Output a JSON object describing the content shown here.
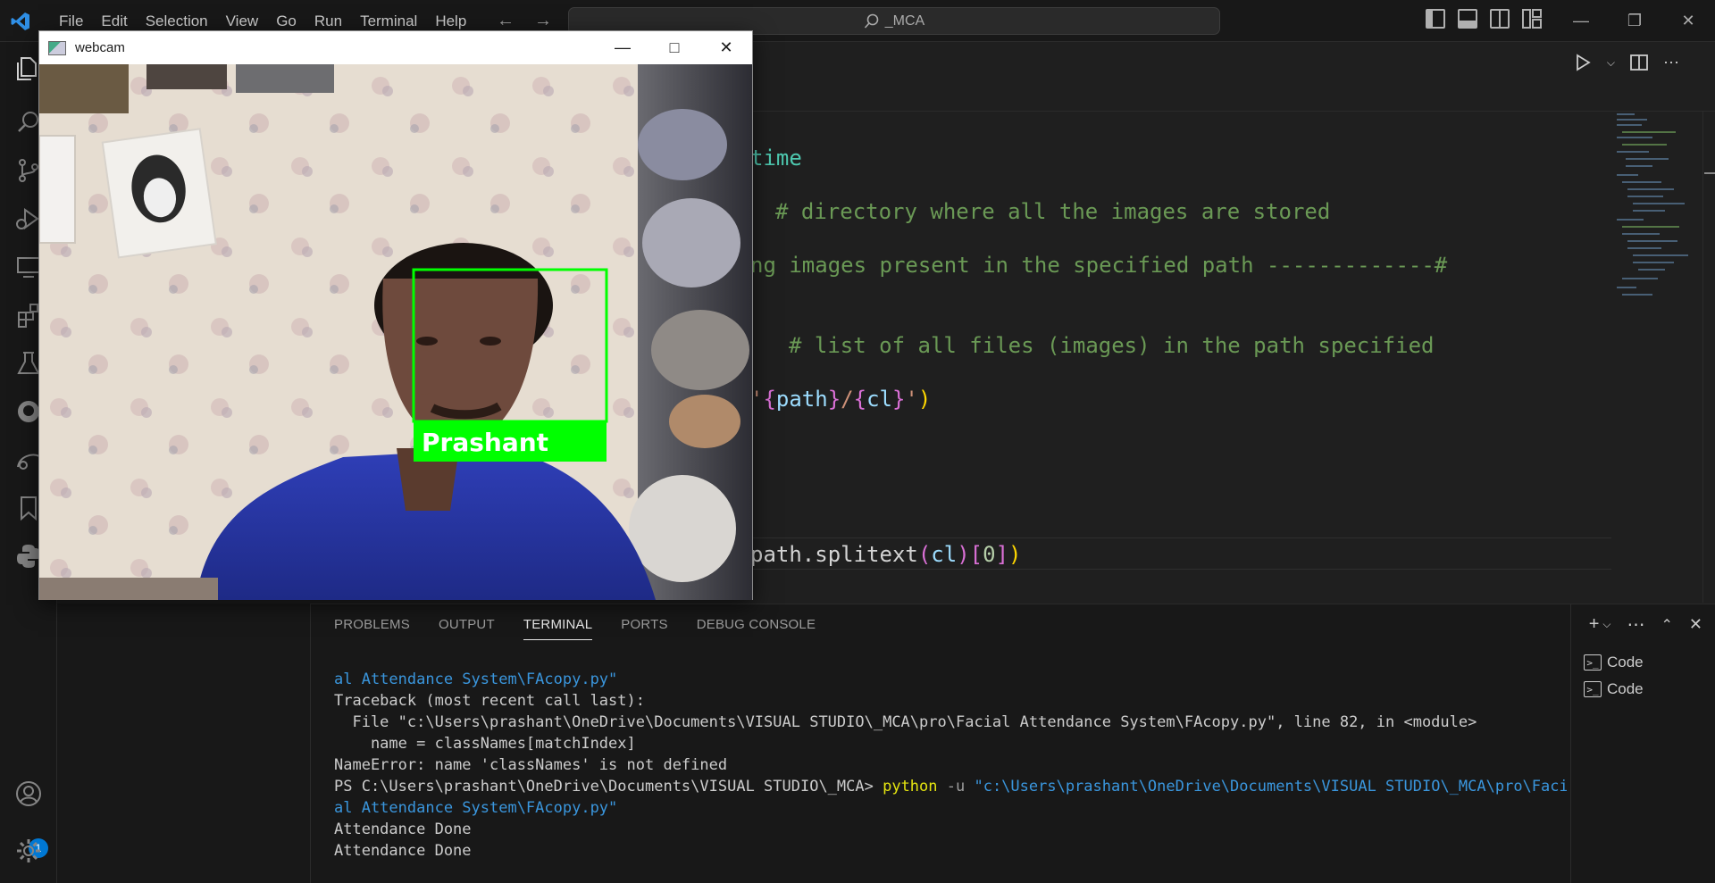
{
  "titlebar": {
    "menu": [
      "File",
      "Edit",
      "Selection",
      "View",
      "Go",
      "Run",
      "Terminal",
      "Help"
    ],
    "search": "_MCA"
  },
  "activity_badge": "1",
  "code_lines": {
    "l1": "time",
    "l2": "# directory where all the images are stored",
    "l3": "ng images present in the specified path -------------#",
    "l4": "# list of all files (images) in the path specified",
    "l5": {
      "a": "'",
      "b": "{",
      "c": "path",
      "d": "}",
      "e": "/",
      "f": "{",
      "g": "cl",
      "h": "}",
      "i": "'",
      "j": ")"
    },
    "l6": {
      "a": "path.splitext",
      "b": "(",
      "c": "cl",
      "d": ")",
      "e": "[",
      "f": "0",
      "g": "]",
      "h": ")"
    }
  },
  "panel": {
    "tabs": [
      "PROBLEMS",
      "OUTPUT",
      "TERMINAL",
      "PORTS",
      "DEBUG CONSOLE"
    ],
    "active_tab": "TERMINAL",
    "terminal_lines": [
      {
        "text": "al Attendance System\\FAcopy.py\"",
        "kind": "link"
      },
      {
        "text": "Traceback (most recent call last):",
        "kind": "plain"
      },
      {
        "text": "  File \"c:\\Users\\prashant\\OneDrive\\Documents\\VISUAL STUDIO\\_MCA\\pro\\Facial Attendance System\\FAcopy.py\", line 82, in <module>",
        "kind": "plain"
      },
      {
        "text": "    name = classNames[matchIndex]",
        "kind": "plain"
      },
      {
        "text": "NameError: name 'classNames' is not defined",
        "kind": "plain"
      }
    ],
    "prompt": {
      "ps": "PS C:\\Users\\prashant\\OneDrive\\Documents\\VISUAL STUDIO\\_MCA> ",
      "cmd": "python",
      "flag": " -u ",
      "arg": "\"c:\\Users\\prashant\\OneDrive\\Documents\\VISUAL STUDIO\\_MCA\\pro\\Faci"
    },
    "after_lines": [
      {
        "text": "al Attendance System\\FAcopy.py\"",
        "kind": "link"
      },
      {
        "text": "Attendance Done",
        "kind": "plain"
      },
      {
        "text": "Attendance Done",
        "kind": "plain"
      }
    ],
    "terminals": [
      "Code",
      "Code"
    ]
  },
  "webcam": {
    "title": "webcam",
    "face_label": "Prashant",
    "colors": {
      "box": "#00ff00",
      "label_text": "#ffffff"
    }
  }
}
